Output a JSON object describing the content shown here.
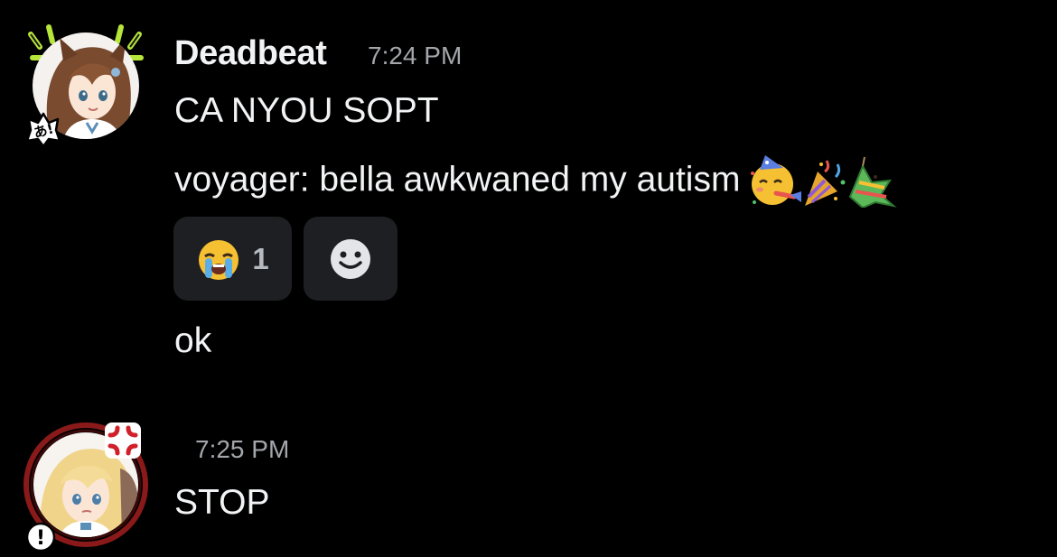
{
  "theme": {
    "background": "#000000",
    "text": "#f2f3f5",
    "muted": "#a3a6aa",
    "reaction_bg": "#1e1f22"
  },
  "messages": [
    {
      "author": "Deadbeat",
      "timestamp": "7:24 PM",
      "avatar_badge_text": "あ!",
      "lines": [
        {
          "text": "CA NYOU SOPT"
        },
        {
          "text": "voyager: bella awkwaned my autism",
          "emoji_icons": [
            "partying-face-icon",
            "party-popper-icon",
            "pinata-icon"
          ]
        },
        {
          "text": "ok"
        }
      ],
      "reactions": [
        {
          "icon": "loudly-crying-face-icon",
          "count": "1"
        },
        {
          "icon": "add-reaction-smiley-icon",
          "count": ""
        }
      ]
    },
    {
      "author": "",
      "timestamp": "7:25 PM",
      "avatar_badge_text": "!",
      "lines": [
        {
          "text": "STOP"
        }
      ]
    }
  ]
}
